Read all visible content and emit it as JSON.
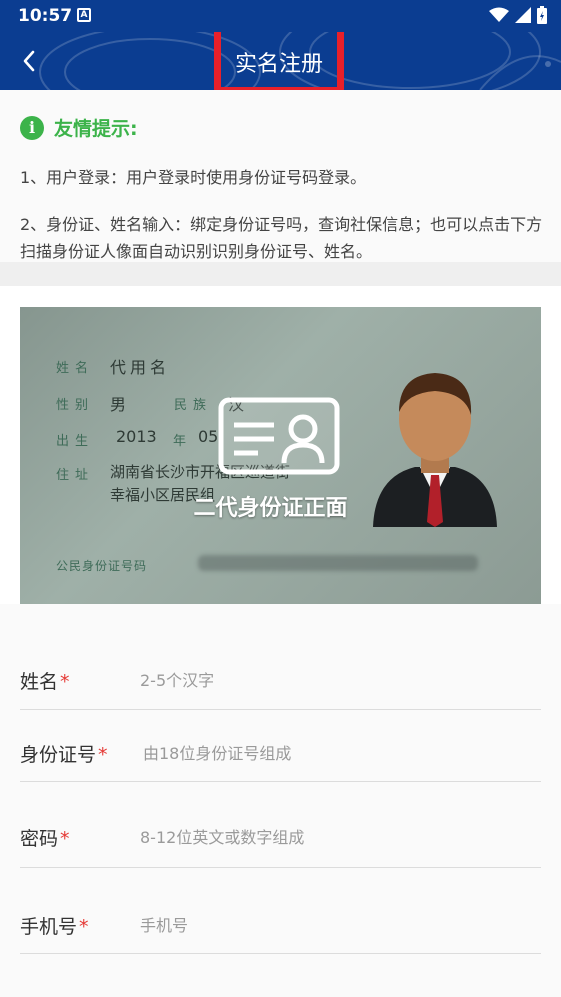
{
  "status_bar": {
    "time": "10:57",
    "a_badge": "A"
  },
  "nav": {
    "title": "实名注册"
  },
  "tips": {
    "title": "友情提示:",
    "info_icon_glyph": "i",
    "line1": "1、用户登录：用户登录时使用身份证号码登录。",
    "line2": "2、身份证、姓名输入：绑定身份证号吗，查询社保信息；也可以点击下方扫描身份证人像面自动识别识别身份证号、姓名。"
  },
  "id_card": {
    "name_label": "姓名",
    "name_value": "代用名",
    "gender_label": "性别",
    "gender_value": "男",
    "ethnic_label": "民族",
    "ethnic_value": "汉",
    "birth_label": "出生",
    "birth_year": "2013",
    "birth_year_unit": "年",
    "birth_month": "05",
    "address_label": "住址",
    "address_line1": "湖南省长沙市开福区巡道街",
    "address_line2": "幸福小区居民组",
    "id_number_label": "公民身份证号码",
    "overlay_text": "二代身份证正面"
  },
  "form": {
    "fields": [
      {
        "label": "姓名",
        "required": "*",
        "placeholder": "2-5个汉字"
      },
      {
        "label": "身份证号",
        "required": "*",
        "placeholder": "由18位身份证号组成"
      },
      {
        "label": "密码",
        "required": "*",
        "placeholder": "8-12位英文或数字组成"
      },
      {
        "label": "手机号",
        "required": "*",
        "placeholder": "手机号"
      }
    ]
  },
  "colors": {
    "header_blue": "#0b3d91",
    "highlight_red": "#e8202a",
    "tips_green": "#3cb34a",
    "required_red": "#e53935"
  }
}
